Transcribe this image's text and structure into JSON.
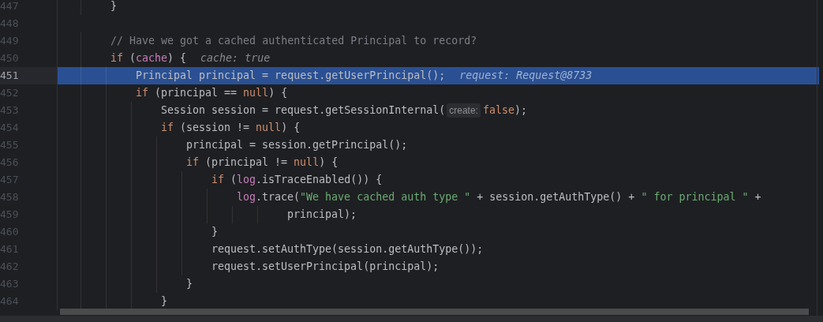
{
  "editor": {
    "lines": [
      {
        "number": "447",
        "selected": false,
        "tokens": [
          {
            "kind": "plain",
            "text": "        }"
          }
        ]
      },
      {
        "number": "448",
        "selected": false
      },
      {
        "number": "449",
        "selected": false,
        "tokens": [
          {
            "kind": "comment",
            "text": "        // Have we got a cached authenticated Principal to record?"
          }
        ]
      },
      {
        "number": "450",
        "selected": false,
        "tokens": [
          {
            "kind": "keyword",
            "text": "        if"
          },
          {
            "kind": "plain",
            "text": " ("
          },
          {
            "kind": "field",
            "text": "cache"
          },
          {
            "kind": "plain",
            "text": ") {"
          }
        ],
        "hint": "cache: true"
      },
      {
        "number": "451",
        "selected": true,
        "tokens": [
          {
            "kind": "plain",
            "text": "            Principal principal = request.getUserPrincipal();"
          }
        ],
        "hint": "request: Request@8733"
      },
      {
        "number": "452",
        "selected": false,
        "tokens": [
          {
            "kind": "keyword",
            "text": "            if"
          },
          {
            "kind": "plain",
            "text": " (principal == "
          },
          {
            "kind": "keyword",
            "text": "null"
          },
          {
            "kind": "plain",
            "text": ") {"
          }
        ]
      },
      {
        "number": "453",
        "selected": false,
        "tokens": [
          {
            "kind": "plain",
            "text": "                Session session = request.getSessionInternal("
          },
          {
            "kind": "param",
            "text": "create:"
          },
          {
            "kind": "keyword",
            "text": "false"
          },
          {
            "kind": "plain",
            "text": ");"
          }
        ]
      },
      {
        "number": "454",
        "selected": false,
        "tokens": [
          {
            "kind": "keyword",
            "text": "                if"
          },
          {
            "kind": "plain",
            "text": " (session != "
          },
          {
            "kind": "keyword",
            "text": "null"
          },
          {
            "kind": "plain",
            "text": ") {"
          }
        ]
      },
      {
        "number": "455",
        "selected": false,
        "tokens": [
          {
            "kind": "plain",
            "text": "                    principal = session.getPrincipal();"
          }
        ]
      },
      {
        "number": "456",
        "selected": false,
        "tokens": [
          {
            "kind": "keyword",
            "text": "                    if"
          },
          {
            "kind": "plain",
            "text": " (principal != "
          },
          {
            "kind": "keyword",
            "text": "null"
          },
          {
            "kind": "plain",
            "text": ") {"
          }
        ]
      },
      {
        "number": "457",
        "selected": false,
        "tokens": [
          {
            "kind": "keyword",
            "text": "                        if"
          },
          {
            "kind": "plain",
            "text": " ("
          },
          {
            "kind": "field",
            "text": "log"
          },
          {
            "kind": "plain",
            "text": ".isTraceEnabled()) {"
          }
        ]
      },
      {
        "number": "458",
        "selected": false,
        "tokens": [
          {
            "kind": "field",
            "text": "                            log"
          },
          {
            "kind": "plain",
            "text": ".trace("
          },
          {
            "kind": "string",
            "text": "\"We have cached auth type \""
          },
          {
            "kind": "plain",
            "text": " + session.getAuthType() + "
          },
          {
            "kind": "string",
            "text": "\" for principal \""
          },
          {
            "kind": "plain",
            "text": " +"
          }
        ]
      },
      {
        "number": "459",
        "selected": false,
        "tokens": [
          {
            "kind": "plain",
            "text": "                                    principal);"
          }
        ]
      },
      {
        "number": "460",
        "selected": false,
        "tokens": [
          {
            "kind": "plain",
            "text": "                        }"
          }
        ]
      },
      {
        "number": "461",
        "selected": false,
        "tokens": [
          {
            "kind": "plain",
            "text": "                        request.setAuthType(session.getAuthType());"
          }
        ]
      },
      {
        "number": "462",
        "selected": false,
        "tokens": [
          {
            "kind": "plain",
            "text": "                        request.setUserPrincipal(principal);"
          }
        ]
      },
      {
        "number": "463",
        "selected": false,
        "tokens": [
          {
            "kind": "plain",
            "text": "                    }"
          }
        ]
      },
      {
        "number": "464",
        "selected": false,
        "tokens": [
          {
            "kind": "plain",
            "text": "                }"
          }
        ]
      }
    ]
  }
}
